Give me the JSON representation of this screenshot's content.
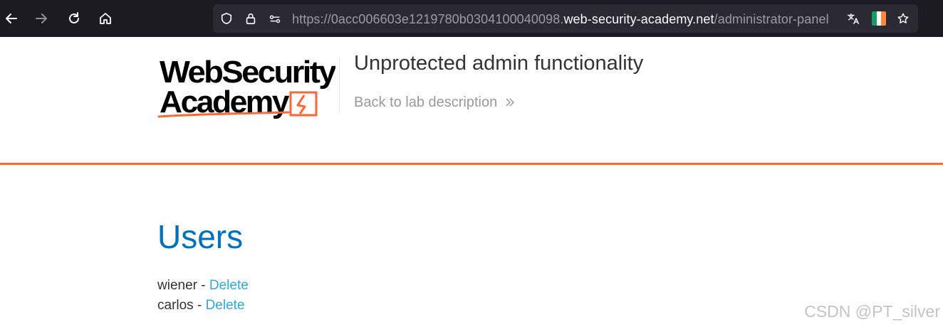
{
  "browser": {
    "url_scheme_prefix": "https://0acc006603e1219780b0304100040098.",
    "url_host": "web-security-academy.net",
    "url_path": "/administrator-panel",
    "flag_colors": [
      "#169b62",
      "#ffffff",
      "#ff883e"
    ]
  },
  "header": {
    "logo_line1": "WebSecurity",
    "logo_line2": "Academy",
    "lab_title": "Unprotected admin functionality",
    "back_link": "Back to lab description"
  },
  "colors": {
    "accent_orange": "#ff6633",
    "heading_blue": "#0071bc",
    "link_blue": "#29abe2"
  },
  "content": {
    "heading": "Users",
    "users": [
      {
        "name": "wiener",
        "separator": " - ",
        "action": "Delete"
      },
      {
        "name": "carlos",
        "separator": " - ",
        "action": "Delete"
      }
    ]
  },
  "watermark": "CSDN @PT_silver"
}
